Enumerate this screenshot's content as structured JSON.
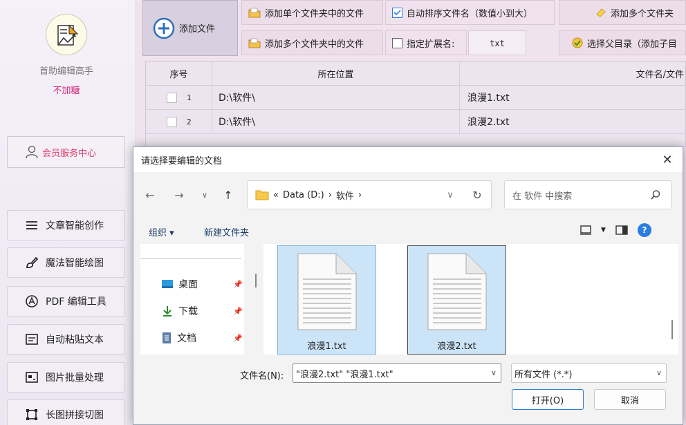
{
  "sidebar": {
    "app_name": "首助编辑高手",
    "app_sub": "不加糖",
    "member_label": "会员服务中心",
    "items": [
      {
        "label": "文章智能创作",
        "icon": "lines-menu-icon"
      },
      {
        "label": "魔法智能绘图",
        "icon": "magic-brush-icon"
      },
      {
        "label": "PDF 编辑工具",
        "icon": "pdf-tool-icon"
      },
      {
        "label": "自动粘贴文本",
        "icon": "paste-text-icon"
      },
      {
        "label": "图片批量处理",
        "icon": "image-batch-icon"
      },
      {
        "label": "长图拼接切图",
        "icon": "crop-frame-icon"
      }
    ]
  },
  "toolbar": {
    "add_file": "添加文件",
    "add_single_folder": "添加单个文件夹中的文件",
    "add_multi_folder": "添加多个文件夹中的文件",
    "auto_sort": "自动排序文件名（数值小到大）",
    "auto_sort_checked": true,
    "specify_ext": "指定扩展名:",
    "specify_ext_checked": false,
    "ext_value": "txt",
    "add_multi_folder_right": "添加多个文件夹",
    "select_parent": "选择父目录（添加子目"
  },
  "table": {
    "columns": [
      "序号",
      "所在位置",
      "文件名/文件"
    ],
    "rows": [
      {
        "num": "1",
        "location": "D:\\软件\\",
        "name": "浪漫1.txt"
      },
      {
        "num": "2",
        "location": "D:\\软件\\",
        "name": "浪漫2.txt"
      }
    ]
  },
  "dialog": {
    "title": "请选择要编辑的文档",
    "breadcrumb": {
      "prefix": "«",
      "drive": "Data (D:)",
      "sep": "›",
      "folder": "软件"
    },
    "search_placeholder": "在 软件 中搜索",
    "organize": "组织 ▾",
    "new_folder": "新建文件夹",
    "nav_items": [
      {
        "label": "桌面",
        "icon": "desktop-icon"
      },
      {
        "label": "下载",
        "icon": "download-icon"
      },
      {
        "label": "文档",
        "icon": "documents-icon"
      }
    ],
    "files": [
      {
        "name": "浪漫1.txt"
      },
      {
        "name": "浪漫2.txt"
      }
    ],
    "filename_label": "文件名(N):",
    "filename_value": "\"浪漫2.txt\" \"浪漫1.txt\"",
    "filetype_value": "所有文件 (*.*)",
    "open_label": "打开(O)",
    "cancel_label": "取消"
  }
}
